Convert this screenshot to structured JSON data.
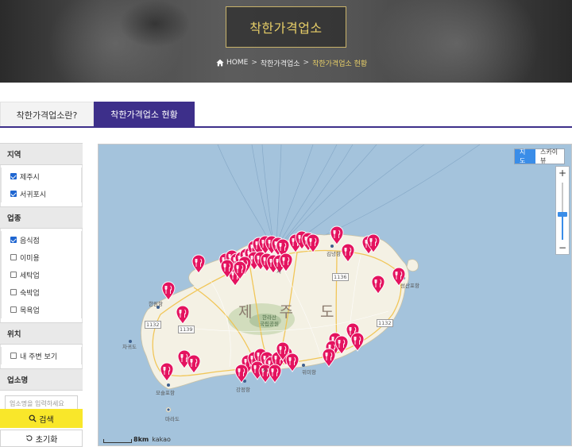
{
  "header": {
    "title": "착한가격업소",
    "breadcrumb": {
      "home": "HOME",
      "level1": "착한가격업소",
      "level2": "착한가격업소 현황",
      "separator": ">"
    }
  },
  "tabs": [
    {
      "label": "착한가격업소란?",
      "active": false
    },
    {
      "label": "착한가격업소 현황",
      "active": true
    }
  ],
  "sidebar": {
    "region": {
      "title": "지역",
      "options": [
        {
          "label": "제주시",
          "checked": true
        },
        {
          "label": "서귀포시",
          "checked": true
        }
      ]
    },
    "industry": {
      "title": "업종",
      "options": [
        {
          "label": "음식점",
          "checked": true
        },
        {
          "label": "이미용",
          "checked": false
        },
        {
          "label": "세탁업",
          "checked": false
        },
        {
          "label": "숙박업",
          "checked": false
        },
        {
          "label": "목욕업",
          "checked": false
        }
      ]
    },
    "location": {
      "title": "위치",
      "options": [
        {
          "label": "내 주변 보기",
          "checked": false
        }
      ]
    },
    "name": {
      "title": "업소명",
      "placeholder": "업소명을 입력하세요",
      "value": ""
    },
    "search_label": "검색",
    "reset_label": "초기화"
  },
  "map": {
    "type_map": "지도",
    "type_skyview": "스카이뷰",
    "zoom_in": "+",
    "zoom_out": "−",
    "scale_label": "8km",
    "provider": "kakao",
    "island_label": "제 주 도",
    "mountain_label": "한라산",
    "park_label": "국립공원",
    "places": {
      "jeju_city": "시",
      "gimnyeong": "김녕항",
      "seongsan": "성산포항",
      "hallim": "한림항",
      "chagwido": "차귀도",
      "wimi": "위미항",
      "gangjeong": "강정항",
      "seogwipo_city": "시",
      "moseulpo": "모슬포항",
      "marado": "마라도"
    },
    "roads": {
      "r1132": "1132",
      "r1136": "1136",
      "r1139": "1139",
      "r1132b": "1132"
    },
    "marker_count": 57,
    "colors": {
      "sea": "#a4c3dc",
      "land": "#f4f1e4",
      "marker": "#e4135f",
      "road": "#f1c24a"
    }
  },
  "colors": {
    "accent": "#3d2f8a",
    "gold": "#e8cf68",
    "search_button": "#f9e72a",
    "map_toggle_active": "#3a8de8"
  }
}
